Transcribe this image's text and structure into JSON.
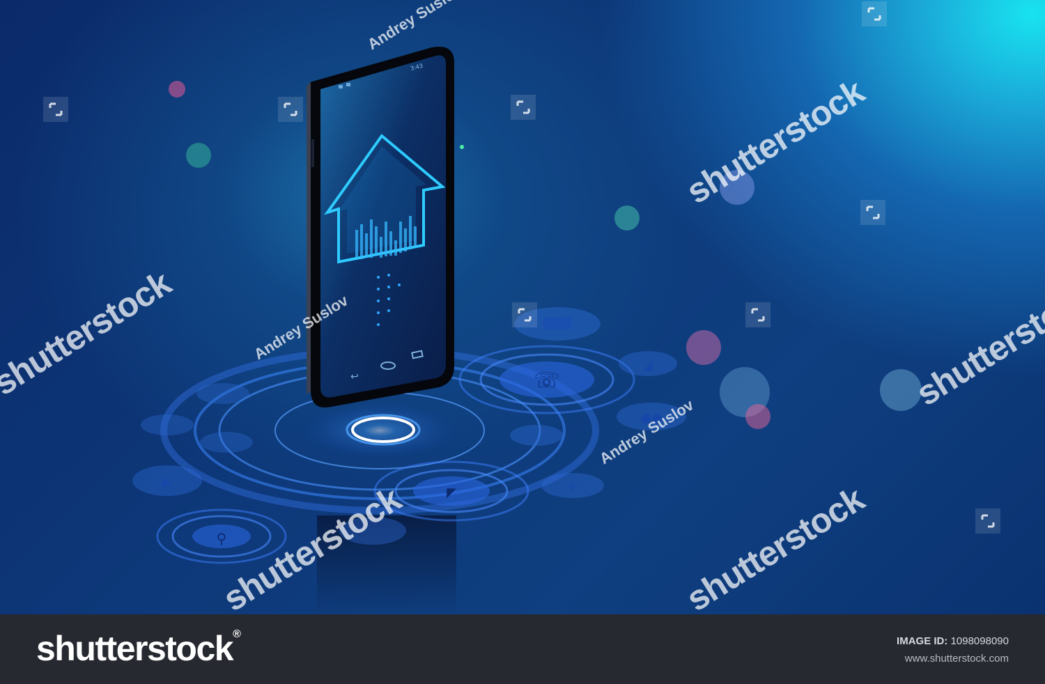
{
  "watermark": {
    "brand": "shutterstock",
    "author": "Andrey Suslov"
  },
  "footer": {
    "logo_text": "shutterstock",
    "image_id_label": "IMAGE ID:",
    "image_id_value": "1098098090",
    "website": "www.shutterstock.com"
  },
  "phone": {
    "status_time": "3:43"
  },
  "colors": {
    "glow": "#3b8bff",
    "accent": "#25c9ff",
    "footer_bg": "#262930"
  }
}
